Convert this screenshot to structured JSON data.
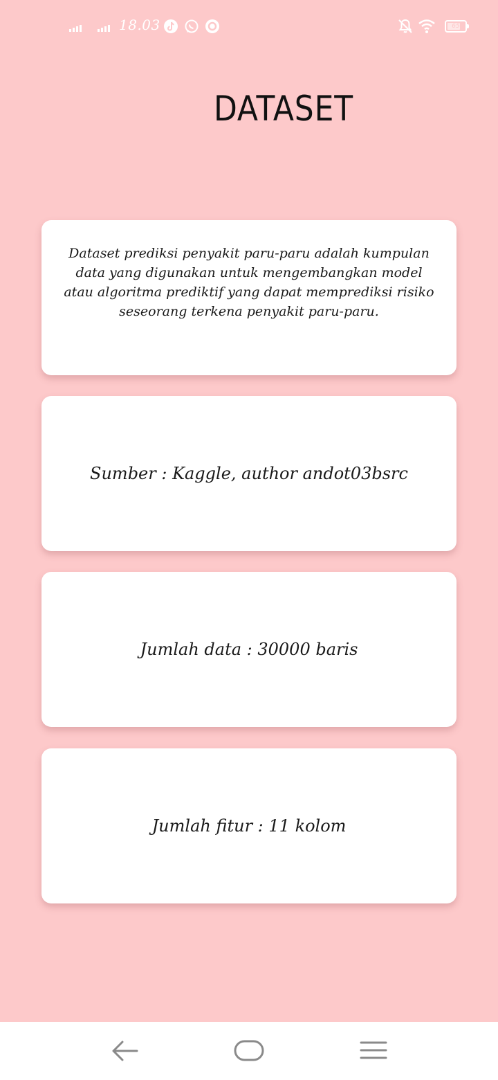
{
  "status_bar": {
    "time": "18.03",
    "battery": "65",
    "icons": [
      "signal-icon",
      "signal-icon",
      "tiktok-icon",
      "whatsapp-icon",
      "circle-app-icon",
      "mute-notification-icon",
      "wifi-icon",
      "battery-icon"
    ]
  },
  "page": {
    "title": "DATASET"
  },
  "cards": {
    "description": "Dataset prediksi penyakit paru-paru adalah kumpulan data yang digunakan untuk mengembangkan model atau algoritma prediktif yang dapat memprediksi risiko seseorang terkena penyakit paru-paru.",
    "source": "Sumber : Kaggle, author andot03bsrc",
    "rows": "Jumlah data : 30000 baris",
    "features": "Jumlah fitur : 11 kolom"
  },
  "navigation": {
    "buttons": [
      "back-icon",
      "home-icon",
      "menu-icon"
    ]
  },
  "colors": {
    "background": "#fdc9ca",
    "card": "#ffffff",
    "text": "#111111",
    "nav_icon": "#8a8a8a"
  }
}
